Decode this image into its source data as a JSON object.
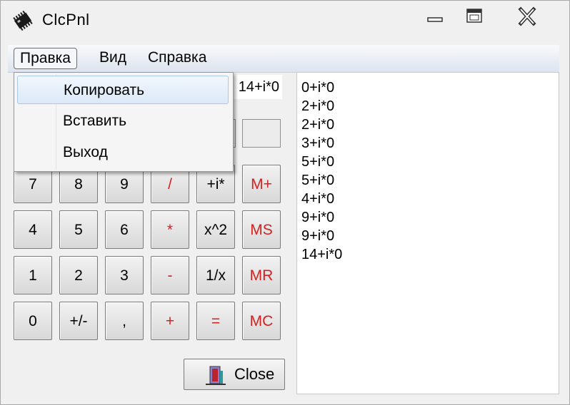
{
  "window": {
    "title": "ClcPnl"
  },
  "menubar": {
    "edit": "Правка",
    "view": "Вид",
    "help": "Справка"
  },
  "dropdown": {
    "copy": "Копировать",
    "paste": "Вставить",
    "exit": "Выход"
  },
  "display": {
    "value": "14+i*0"
  },
  "keypad": {
    "row1": [
      "7",
      "8",
      "9",
      "/",
      "+i*",
      "M+"
    ],
    "row2": [
      "4",
      "5",
      "6",
      "*",
      "x^2",
      "MS"
    ],
    "row3": [
      "1",
      "2",
      "3",
      "-",
      "1/x",
      "MR"
    ],
    "row4": [
      "0",
      "+/-",
      ",",
      "+",
      "=",
      "MC"
    ]
  },
  "history": [
    "0+i*0",
    "2+i*0",
    "2+i*0",
    "3+i*0",
    "5+i*0",
    "5+i*0",
    "4+i*0",
    "9+i*0",
    "9+i*0",
    "14+i*0"
  ],
  "close_button": {
    "label": "Close"
  },
  "icons": {
    "app": "chip-icon",
    "minimize": "minimize-icon",
    "maximize": "maximize-icon",
    "close": "close-icon",
    "close_button": "door-exit-icon"
  },
  "colors": {
    "accent_red": "#d42020",
    "menu_highlight": "#dbe9f8"
  }
}
